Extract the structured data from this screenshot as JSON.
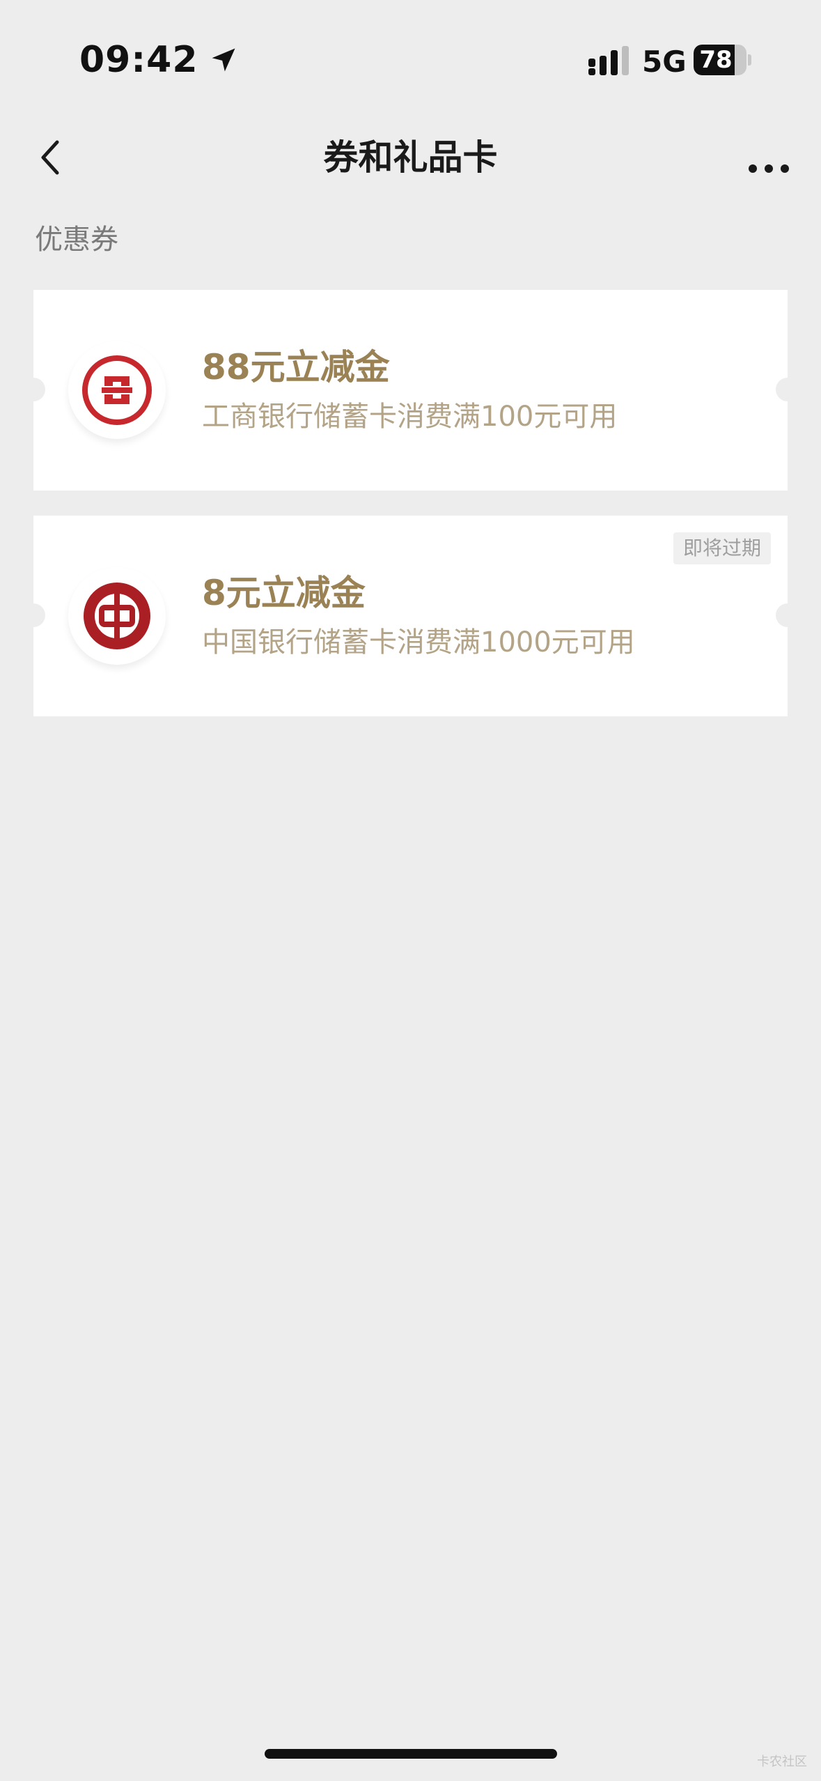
{
  "status_bar": {
    "time": "09:42",
    "network": "5G",
    "battery_level": 78,
    "battery_text": "78"
  },
  "nav": {
    "title": "券和礼品卡"
  },
  "section": {
    "label": "优惠券"
  },
  "coupons": [
    {
      "title": "88元立减金",
      "description": "工商银行储蓄卡消费满100元可用",
      "badge": "",
      "logo_icon": "icbc-logo-icon",
      "logo_color": "#c7282e"
    },
    {
      "title": "8元立减金",
      "description": "中国银行储蓄卡消费满1000元可用",
      "badge": "即将过期",
      "logo_icon": "boc-logo-icon",
      "logo_color": "#a91f24"
    }
  ],
  "colors": {
    "background": "#ededed",
    "coupon_title": "#9a8255",
    "coupon_desc": "#b3a387"
  },
  "watermark": "卡农社区"
}
